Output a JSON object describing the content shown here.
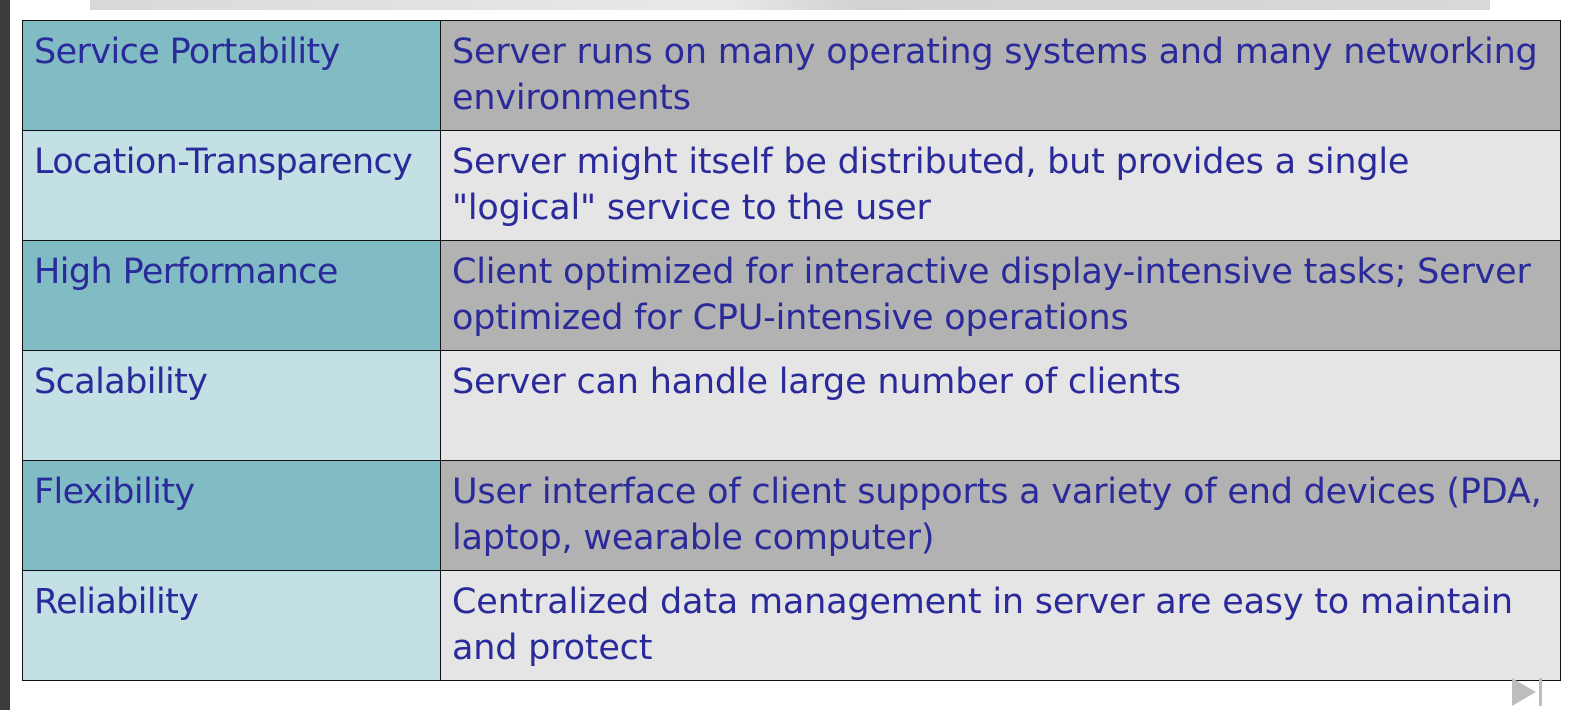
{
  "rows": [
    {
      "key": "Service Portability",
      "value": "Server runs on many operating systems and many networking environments"
    },
    {
      "key": "Location-Transparency",
      "value": "Server might itself be distributed, but provides a single \"logical\" service to the user"
    },
    {
      "key": "High Performance",
      "value": "Client optimized for interactive display-intensive tasks; Server optimized for CPU-intensive operations"
    },
    {
      "key": "Scalability",
      "value": "Server can handle large number of clients"
    },
    {
      "key": "Flexibility",
      "value": "User interface of client supports a variety of end devices (PDA, laptop, wearable computer)"
    },
    {
      "key": "Reliability",
      "value": "Centralized data management in server are easy to maintain and protect"
    }
  ],
  "colors": {
    "text": "#2a2a9a",
    "key_dark": "#81bcc4",
    "key_light": "#c3e1e4",
    "value_dark": "#b2b2b2",
    "value_light": "#e5e5e5"
  },
  "icons": {
    "end_button": "skip-to-end-icon"
  }
}
